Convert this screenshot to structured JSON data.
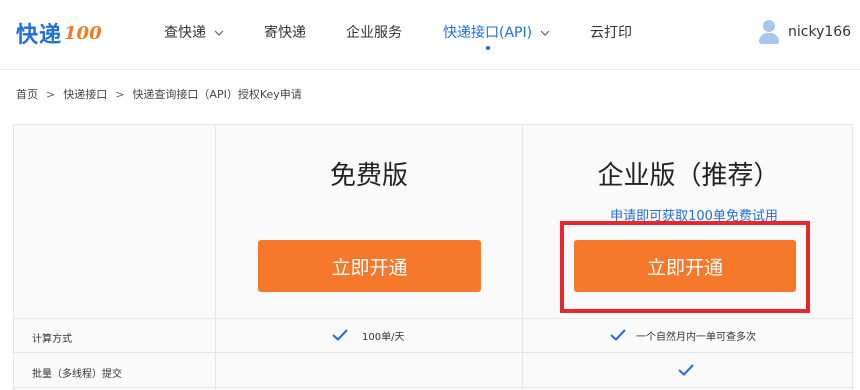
{
  "brand": {
    "logo_text": "快递",
    "logo_suffix": "100",
    "colors": {
      "primary": "#1e6fd9",
      "accent": "#f6782a",
      "highlight": "#e8262b"
    }
  },
  "nav": {
    "items": [
      {
        "label": "查快递",
        "has_dropdown": true,
        "active": false
      },
      {
        "label": "寄快递",
        "has_dropdown": false,
        "active": false
      },
      {
        "label": "企业服务",
        "has_dropdown": false,
        "active": false
      },
      {
        "label": "快递接口(API)",
        "has_dropdown": true,
        "active": true
      },
      {
        "label": "云打印",
        "has_dropdown": false,
        "active": false
      }
    ]
  },
  "user": {
    "name": "nicky166",
    "icon": "user-avatar-icon"
  },
  "breadcrumb": {
    "items": [
      "首页",
      "快递接口",
      "快递查询接口（API）授权Key申请"
    ],
    "separator": ">"
  },
  "plans": {
    "free": {
      "title": "免费版",
      "button": "立即开通"
    },
    "enterprise": {
      "title": "企业版（推荐）",
      "trial_link": "申请即可获取100单免费试用",
      "button": "立即开通"
    }
  },
  "features": [
    {
      "label": "计算方式",
      "free": "100单/天",
      "enterprise": "一个自然月内一单可查多次",
      "free_check": true,
      "enterprise_check": true
    },
    {
      "label": "批量（多线程）提交",
      "free": "",
      "enterprise": "",
      "free_check": false,
      "enterprise_check": true
    }
  ]
}
